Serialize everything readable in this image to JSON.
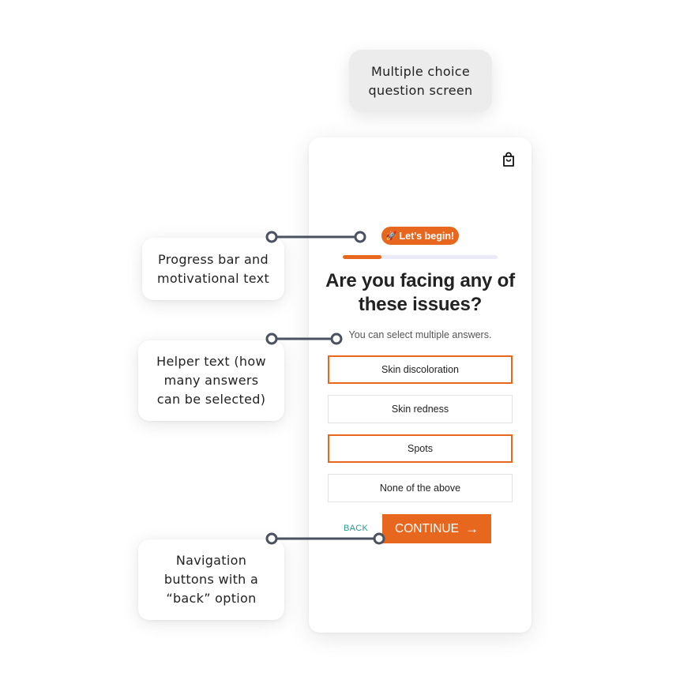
{
  "annotations": {
    "title": "Multiple choice\nquestion screen",
    "progress": "Progress bar and\nmotivational text",
    "helper": "Helper text (how\nmany answers\ncan be selected)",
    "navigation": "Navigation\nbuttons with a\n“back” option"
  },
  "screen": {
    "cart_icon": "shopping-bag-icon",
    "badge": {
      "icon": "rocket-icon",
      "glyph": "🚀",
      "label": "Let's begin!"
    },
    "progress": {
      "value": 0.25
    },
    "question": "Are you facing any of these issues?",
    "helper": "You can select multiple answers.",
    "options": [
      {
        "label": "Skin discoloration",
        "selected": true
      },
      {
        "label": "Skin redness",
        "selected": false
      },
      {
        "label": "Spots",
        "selected": true
      },
      {
        "label": "None of the above",
        "selected": false
      }
    ],
    "nav": {
      "back": "BACK",
      "continue": "CONTINUE",
      "continue_icon": "arrow-right-icon"
    }
  },
  "colors": {
    "accent": "#e8671f",
    "back": "#2a9d8f",
    "connector": "#4a5260"
  }
}
